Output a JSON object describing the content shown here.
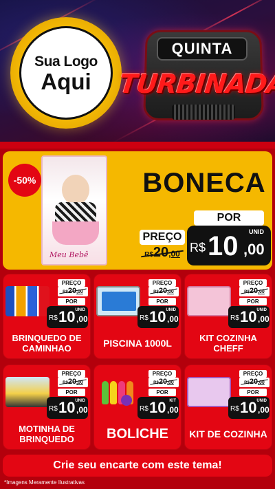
{
  "header": {
    "logo_line1": "Sua Logo",
    "logo_line2": "Aqui",
    "badge_top": "QUINTA",
    "badge_main": "TURBINADA"
  },
  "featured": {
    "discount": "-50%",
    "title": "BONECA",
    "photo_label": "Meu Bebê",
    "preco_label": "PREÇO",
    "old_currency": "R$",
    "old_int": "20",
    "old_cents": ",00",
    "por_label": "POR",
    "unit": "UNID",
    "currency": "R$",
    "price_int": "10",
    "price_cents": ",00"
  },
  "products": [
    {
      "name": "BRINQUEDO DE CAMINHAO",
      "preco_label": "PREÇO",
      "old_currency": "R$",
      "old_int": "20",
      "old_cents": ",00",
      "por_label": "POR",
      "unit": "UNID",
      "currency": "R$",
      "price_int": "10",
      "price_cents": ",00"
    },
    {
      "name": "PISCINA 1000L",
      "preco_label": "PREÇO",
      "old_currency": "R$",
      "old_int": "20",
      "old_cents": ",00",
      "por_label": "POR",
      "unit": "UNID",
      "currency": "R$",
      "price_int": "10",
      "price_cents": ",00"
    },
    {
      "name": "KIT COZINHA CHEFF",
      "preco_label": "PREÇO",
      "old_currency": "R$",
      "old_int": "20",
      "old_cents": ",00",
      "por_label": "POR",
      "unit": "UNID",
      "currency": "R$",
      "price_int": "10",
      "price_cents": ",00"
    },
    {
      "name": "MOTINHA DE BRINQUEDO",
      "preco_label": "PREÇO",
      "old_currency": "R$",
      "old_int": "20",
      "old_cents": ",00",
      "por_label": "POR",
      "unit": "UNID",
      "currency": "R$",
      "price_int": "10",
      "price_cents": ",00"
    },
    {
      "name": "BOLICHE",
      "preco_label": "PREÇO",
      "old_currency": "R$",
      "old_int": "20",
      "old_cents": ",00",
      "por_label": "POR",
      "unit": "KIT",
      "currency": "R$",
      "price_int": "10",
      "price_cents": ",00"
    },
    {
      "name": "KIT DE COZINHA",
      "preco_label": "PREÇO",
      "old_currency": "R$",
      "old_int": "20",
      "old_cents": ",00",
      "por_label": "POR",
      "unit": "UNID",
      "currency": "R$",
      "price_int": "10",
      "price_cents": ",00"
    }
  ],
  "cta": "Crie seu encarte com este tema!",
  "footnote": "*Imagens Meramente Ilustrativas",
  "colors": {
    "primary_red": "#e30613",
    "featured_yellow": "#f5b800",
    "logo_gold": "#f2b705",
    "dark": "#111111"
  }
}
